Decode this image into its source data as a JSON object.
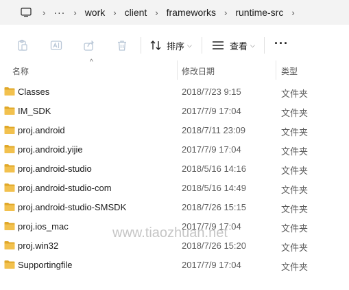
{
  "breadcrumb": {
    "more": "···",
    "items": [
      "work",
      "client",
      "frameworks",
      "runtime-src"
    ]
  },
  "toolbar": {
    "sort_label": "排序",
    "view_label": "查看",
    "more": "···"
  },
  "columns": {
    "name": "名称",
    "date": "修改日期",
    "type": "类型"
  },
  "files": [
    {
      "name": "Classes",
      "date": "2018/7/23 9:15",
      "type": "文件夹"
    },
    {
      "name": "IM_SDK",
      "date": "2017/7/9 17:04",
      "type": "文件夹"
    },
    {
      "name": "proj.android",
      "date": "2018/7/11 23:09",
      "type": "文件夹"
    },
    {
      "name": "proj.android.yijie",
      "date": "2017/7/9 17:04",
      "type": "文件夹"
    },
    {
      "name": "proj.android-studio",
      "date": "2018/5/16 14:16",
      "type": "文件夹"
    },
    {
      "name": "proj.android-studio-com",
      "date": "2018/5/16 14:49",
      "type": "文件夹"
    },
    {
      "name": "proj.android-studio-SMSDK",
      "date": "2018/7/26 15:15",
      "type": "文件夹"
    },
    {
      "name": "proj.ios_mac",
      "date": "2017/7/9 17:04",
      "type": "文件夹"
    },
    {
      "name": "proj.win32",
      "date": "2018/7/26 15:20",
      "type": "文件夹"
    },
    {
      "name": "Supportingfile",
      "date": "2017/7/9 17:04",
      "type": "文件夹"
    }
  ],
  "watermark": "www.tiaozhuan.net",
  "colors": {
    "folder": "#f2c14e",
    "folder_dark": "#e0a829",
    "disabled_icon": "#b8c6d6"
  }
}
